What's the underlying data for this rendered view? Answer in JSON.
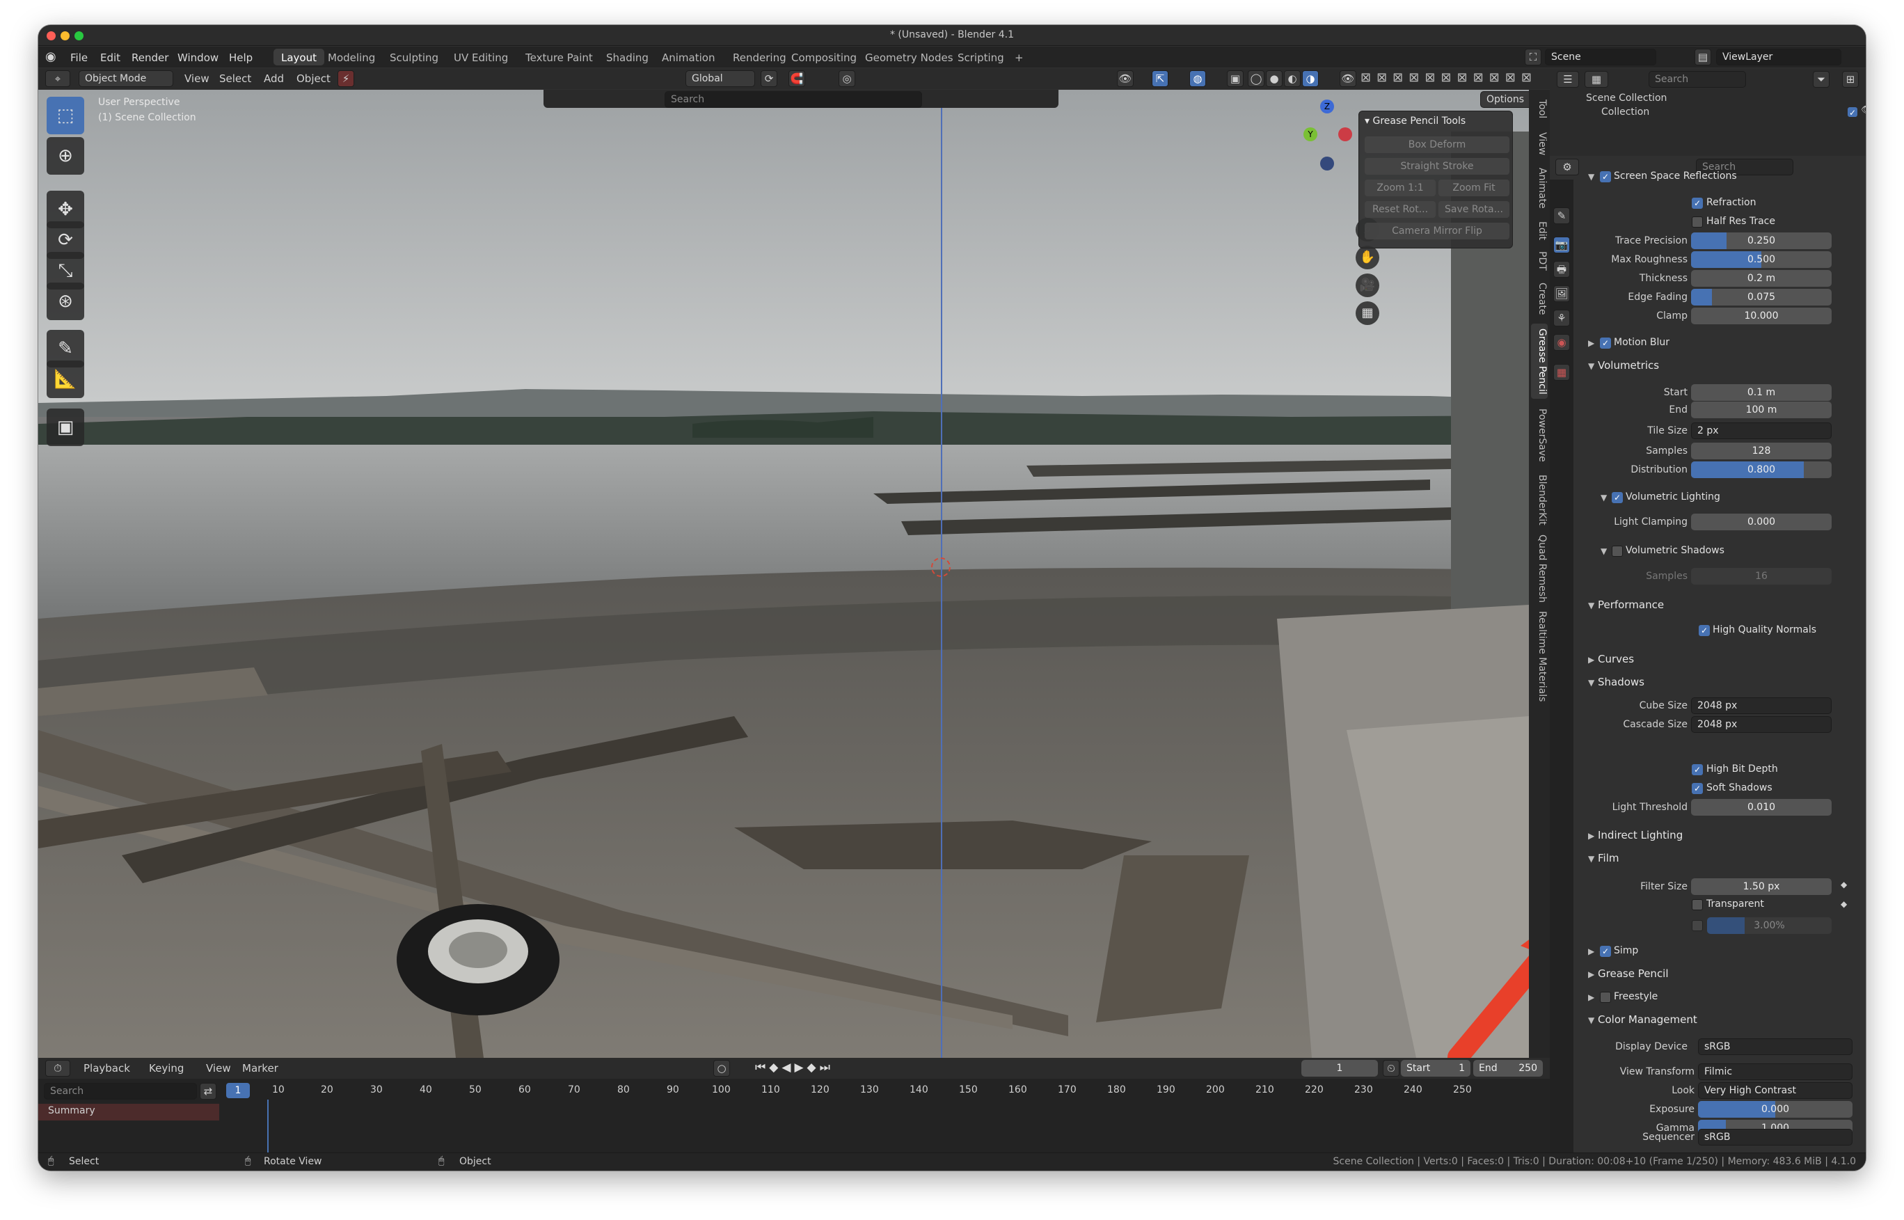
{
  "window": {
    "title": "* (Unsaved) - Blender 4.1"
  },
  "menu": {
    "items": [
      "File",
      "Edit",
      "Render",
      "Window",
      "Help"
    ]
  },
  "workspaces": [
    "Layout",
    "Modeling",
    "Sculpting",
    "UV Editing",
    "Texture Paint",
    "Shading",
    "Animation",
    "Rendering",
    "Compositing",
    "Geometry Nodes",
    "Scripting"
  ],
  "top_right": {
    "scene": "Scene",
    "view_layer": "ViewLayer"
  },
  "viewport_header": {
    "mode": "Object Mode",
    "view": "View",
    "select": "Select",
    "add": "Add",
    "object": "Object",
    "orientation": "Global",
    "search_placeholder": "Search",
    "options": "Options"
  },
  "overlay_text": {
    "perspective": "User Perspective",
    "collection": "(1) Scene Collection"
  },
  "grease_pencil": {
    "title": "Grease Pencil Tools",
    "box_deform": "Box Deform",
    "straight_stroke": "Straight Stroke",
    "zoom_11": "Zoom 1:1",
    "zoom_fit": "Zoom Fit",
    "reset_rot": "Reset Rot...",
    "save_rota": "Save Rota...",
    "camera_mirror": "Camera Mirror Flip"
  },
  "gizmo": {
    "z": "Z",
    "y": "Y"
  },
  "side_tabs": [
    "Tool",
    "View",
    "Animate",
    "Edit",
    "PDT",
    "Create",
    "Grease Pencil",
    "PowerSave",
    "BlenderKit",
    "Quad Remesh",
    "Realtime Materials"
  ],
  "outliner": {
    "search_placeholder": "Search",
    "scene_collection": "Scene Collection",
    "collection": "Collection"
  },
  "properties": {
    "search_placeholder": "Search",
    "ssr": {
      "title": "Screen Space Reflections",
      "refraction": "Refraction",
      "half_res": "Half Res Trace",
      "trace_precision_label": "Trace Precision",
      "trace_precision": "0.250",
      "max_roughness_label": "Max Roughness",
      "max_roughness": "0.500",
      "thickness_label": "Thickness",
      "thickness": "0.2 m",
      "edge_fading_label": "Edge Fading",
      "edge_fading": "0.075",
      "clamp_label": "Clamp",
      "clamp": "10.000"
    },
    "motion_blur": "Motion Blur",
    "volumetrics": {
      "title": "Volumetrics",
      "start_label": "Start",
      "start": "0.1 m",
      "end_label": "End",
      "end": "100 m",
      "tile_size_label": "Tile Size",
      "tile_size": "2 px",
      "samples_label": "Samples",
      "samples": "128",
      "distribution_label": "Distribution",
      "distribution": "0.800",
      "vol_lighting": "Volumetric Lighting",
      "light_clamping_label": "Light Clamping",
      "light_clamping": "0.000",
      "vol_shadows": "Volumetric Shadows",
      "shadow_samples_label": "Samples",
      "shadow_samples": "16"
    },
    "performance": {
      "title": "Performance",
      "hq_normals": "High Quality Normals"
    },
    "curves": "Curves",
    "shadows": {
      "title": "Shadows",
      "cube_size_label": "Cube Size",
      "cube_size": "2048 px",
      "cascade_size_label": "Cascade Size",
      "cascade_size": "2048 px",
      "high_bit": "High Bit Depth",
      "soft": "Soft Shadows",
      "light_threshold_label": "Light Threshold",
      "light_threshold": "0.010"
    },
    "indirect": "Indirect Lighting",
    "film": {
      "title": "Film",
      "filter_size_label": "Filter Size",
      "filter_size": "1.50 px",
      "transparent": "Transparent",
      "overscan": "3.00%"
    },
    "simplify": "Simp",
    "grease_pencil": "Grease Pencil",
    "freestyle": "Freestyle",
    "color_management": {
      "title": "Color Management",
      "display_device_label": "Display Device",
      "display_device": "sRGB",
      "view_transform_label": "View Transform",
      "view_transform": "Filmic",
      "look_label": "Look",
      "look": "Very High Contrast",
      "exposure_label": "Exposure",
      "exposure": "0.000",
      "gamma_label": "Gamma",
      "gamma": "1.000",
      "sequencer_label": "Sequencer",
      "sequencer": "sRGB"
    }
  },
  "timeline": {
    "playback": "Playback",
    "keying": "Keying",
    "view": "View",
    "marker": "Marker",
    "current_frame": "1",
    "start_label": "Start",
    "start": "1",
    "end_label": "End",
    "end": "250",
    "search_placeholder": "Search",
    "summary": "Summary",
    "ruler": [
      "1",
      "10",
      "20",
      "30",
      "40",
      "50",
      "60",
      "70",
      "80",
      "90",
      "100",
      "110",
      "120",
      "130",
      "140",
      "150",
      "160",
      "170",
      "180",
      "190",
      "200",
      "210",
      "220",
      "230",
      "240",
      "250"
    ]
  },
  "statusbar": {
    "select": "Select",
    "rotate": "Rotate View",
    "object": "Object",
    "info": "Scene Collection | Verts:0 | Faces:0 | Tris:0 | Duration: 00:08+10 (Frame 1/250) | Memory: 483.6 MiB | 4.1.0"
  },
  "colors": {
    "accent": "#4772b3",
    "arrow": "#e8402a"
  }
}
